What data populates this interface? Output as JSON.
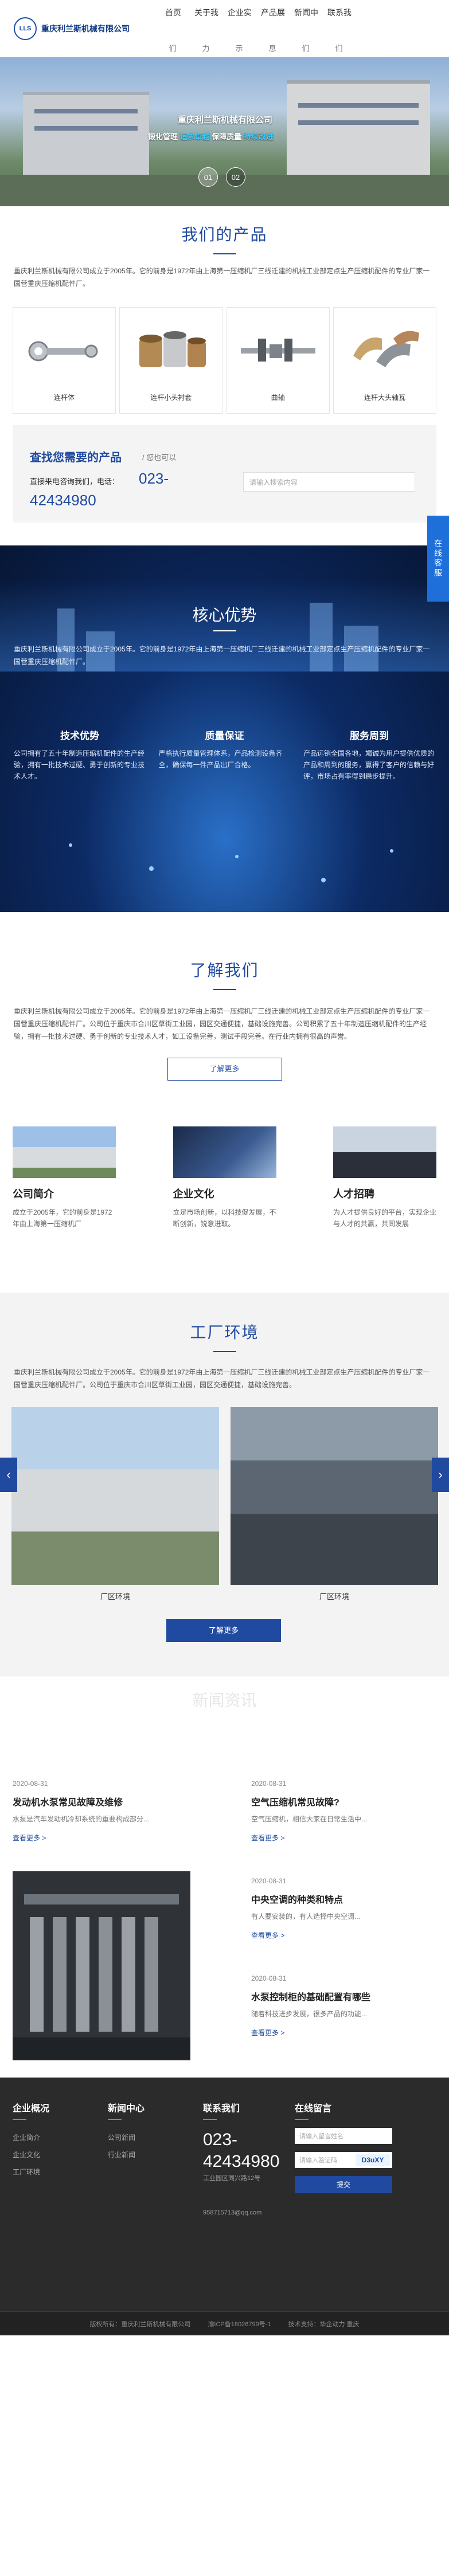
{
  "header": {
    "logo_text": "重庆利兰斯机械有限公司",
    "logo_mark": "LLS",
    "nav": [
      {
        "label": "首页",
        "glyph": "们"
      },
      {
        "label": "关于我",
        "glyph": "力"
      },
      {
        "label": "企业实",
        "glyph": "示"
      },
      {
        "label": "产品展",
        "glyph": "息"
      },
      {
        "label": "新闻中",
        "glyph": "们"
      },
      {
        "label": "联系我",
        "glyph": "们"
      }
    ]
  },
  "hero": {
    "title": "重庆利兰斯机械有限公司",
    "slogan_prefix": "锻化管理 ",
    "slogan_hl1": "追求卓越",
    "slogan_mid": "  保障质量 ",
    "slogan_hl2": "持续改进",
    "dots": [
      "01",
      "02"
    ]
  },
  "products": {
    "title": "我们的产品",
    "desc": "重庆利兰斯机械有限公司成立于2005年。它的前身是1972年由上海第一压缩机厂三线迁建的机械工业部定点生产压缩机配件的专业厂家一国营重庆压缩机配件厂。",
    "items": [
      {
        "name": "连杆体"
      },
      {
        "name": "连杆小头衬套"
      },
      {
        "name": "曲轴"
      },
      {
        "name": "连杆大头轴瓦"
      }
    ]
  },
  "find": {
    "title": "查找您需要的产品",
    "subtitle": "/ 您也可以",
    "tel_label": "直接来电咨询我们，电话：",
    "tel_a": "023-",
    "tel_b": "42434980",
    "search_placeholder": "请输入搜索内容"
  },
  "advantage": {
    "title": "核心优势",
    "desc": "重庆利兰斯机械有限公司成立于2005年。它的前身是1972年由上海第一压缩机厂三线迁建的机械工业部定点生产压缩机配件的专业厂家一国营重庆压缩机配件厂。",
    "cols": [
      {
        "title": "技术优势",
        "text": "公司拥有了五十年制造压缩机配件的生产经验，拥有一批技术过硬、勇于创新的专业技术人才。"
      },
      {
        "title": "质量保证",
        "text": "严格执行质量管理体系，产品检测设备齐全，确保每一件产品出厂合格。"
      },
      {
        "title": "服务周到",
        "text": "产品远销全国各地，竭诚为用户提供优质的产品和周到的服务，赢得了客户的信赖与好评，市场占有率得到稳步提升。"
      }
    ]
  },
  "about": {
    "title": "了解我们",
    "desc": "重庆利兰斯机械有限公司成立于2005年。它的前身是1972年由上海第一压缩机厂三线迁建的机械工业部定点生产压缩机配件的专业厂家一国营重庆压缩机配件厂。公司位于重庆市合川区草街工业园，园区交通便捷，基础设施完善。公司积累了五十年制造压缩机配件的生产经验，拥有一批技术过硬、勇于创新的专业技术人才，如工设备完善，测试手段完善。在行业内拥有很高的声誉。",
    "more": "了解更多",
    "cards": [
      {
        "title": "公司简介",
        "text": "成立于2005年，它的前身是1972年由上海第一压缩机厂"
      },
      {
        "title": "企业文化",
        "text": "立足市场创新，以科技促发展，不断创新，锐意进取。"
      },
      {
        "title": "人才招聘",
        "text": "为人才提供良好的平台，实现企业与人才的共赢，共同发展"
      }
    ]
  },
  "env": {
    "title": "工厂环境",
    "desc": "重庆利兰斯机械有限公司成立于2005年。它的前身是1972年由上海第一压缩机厂三线迁建的机械工业部定点生产压缩机配件的专业厂家一国营重庆压缩机配件厂。公司位于重庆市合川区草街工业园，园区交通便捷，基础设施完善。",
    "captions": [
      "厂区环境",
      "厂区环境"
    ],
    "more": "了解更多",
    "prev": "‹",
    "next": "›"
  },
  "news": {
    "title": "新闻资讯",
    "main": {
      "date": "2020-08-31",
      "title": "发动机水泵常见故障及维修",
      "summary": "水泵是汽车发动机冷却系统的重要构成部分...",
      "more": "查看更多 >"
    },
    "items": [
      {
        "date": "2020-08-31",
        "title": "空气压缩机常见故障?",
        "summary": "空气压缩机，相信大家在日常生活中...",
        "more": "查看更多 >"
      },
      {
        "date": "2020-08-31",
        "title": "中央空调的种类和特点",
        "summary": "有人要安装的，有人选择中央空调...",
        "more": "查看更多 >"
      },
      {
        "date": "2020-08-31",
        "title": "水泵控制柜的基础配置有哪些",
        "summary": "随着科技进步发展，很多产品的功能...",
        "more": "查看更多 >"
      }
    ]
  },
  "footer": {
    "col1": {
      "title": "企业概况",
      "items": [
        "企业简介",
        "企业文化",
        "工厂环境"
      ]
    },
    "col2": {
      "title": "新闻中心",
      "items": [
        "公司新闻",
        "行业新闻"
      ]
    },
    "col3": {
      "title": "联系我们",
      "tel_a": "023-",
      "tel_b": "42434980",
      "addr": "工业园区同兴路12号",
      "email": "958715713@qq.com"
    },
    "col4": {
      "title": "在线留言",
      "name_placeholder": "请输入留言姓名",
      "code_placeholder": "请输入验证码",
      "captcha": "D3uXY",
      "submit": "提交"
    },
    "copyright": [
      "版权所有：重庆利兰斯机械有限公司",
      "渝ICP备18026799号-1",
      "技术支持：华企动力 重庆"
    ]
  },
  "float_tab": "在线客服",
  "colors": {
    "primary": "#1f4aa0",
    "accent": "#33ccff",
    "footer": "#2b2b2b"
  }
}
